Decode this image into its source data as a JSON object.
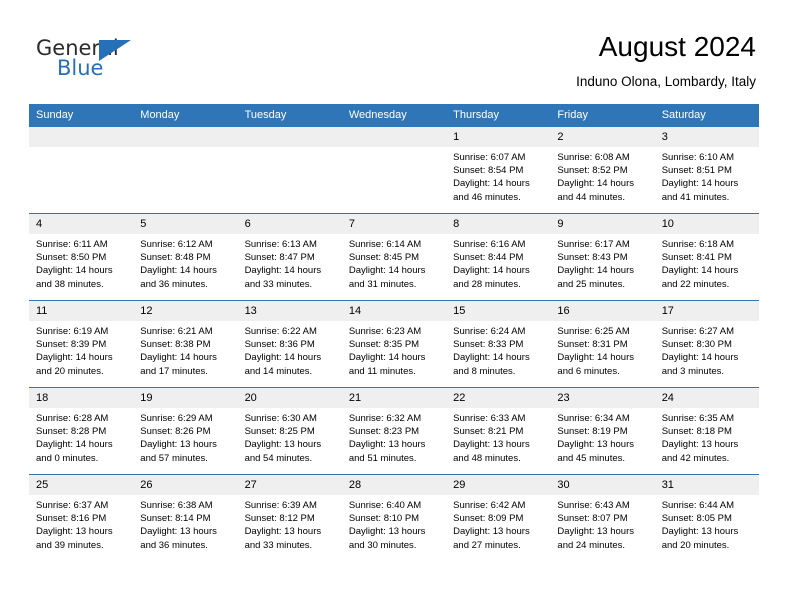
{
  "brand": {
    "word_general": "General",
    "word_blue": "Blue",
    "accent_color": "#2670b7"
  },
  "header": {
    "month_title": "August 2024",
    "location": "Induno Olona, Lombardy, Italy"
  },
  "calendar": {
    "header_color": "#2f76b8",
    "daynum_bg": "#efefef",
    "weekday_headers": [
      "Sunday",
      "Monday",
      "Tuesday",
      "Wednesday",
      "Thursday",
      "Friday",
      "Saturday"
    ],
    "weeks": [
      [
        {
          "day": "",
          "lines": []
        },
        {
          "day": "",
          "lines": []
        },
        {
          "day": "",
          "lines": []
        },
        {
          "day": "",
          "lines": []
        },
        {
          "day": "1",
          "lines": [
            "Sunrise: 6:07 AM",
            "Sunset: 8:54 PM",
            "Daylight: 14 hours",
            "and 46 minutes."
          ]
        },
        {
          "day": "2",
          "lines": [
            "Sunrise: 6:08 AM",
            "Sunset: 8:52 PM",
            "Daylight: 14 hours",
            "and 44 minutes."
          ]
        },
        {
          "day": "3",
          "lines": [
            "Sunrise: 6:10 AM",
            "Sunset: 8:51 PM",
            "Daylight: 14 hours",
            "and 41 minutes."
          ]
        }
      ],
      [
        {
          "day": "4",
          "lines": [
            "Sunrise: 6:11 AM",
            "Sunset: 8:50 PM",
            "Daylight: 14 hours",
            "and 38 minutes."
          ]
        },
        {
          "day": "5",
          "lines": [
            "Sunrise: 6:12 AM",
            "Sunset: 8:48 PM",
            "Daylight: 14 hours",
            "and 36 minutes."
          ]
        },
        {
          "day": "6",
          "lines": [
            "Sunrise: 6:13 AM",
            "Sunset: 8:47 PM",
            "Daylight: 14 hours",
            "and 33 minutes."
          ]
        },
        {
          "day": "7",
          "lines": [
            "Sunrise: 6:14 AM",
            "Sunset: 8:45 PM",
            "Daylight: 14 hours",
            "and 31 minutes."
          ]
        },
        {
          "day": "8",
          "lines": [
            "Sunrise: 6:16 AM",
            "Sunset: 8:44 PM",
            "Daylight: 14 hours",
            "and 28 minutes."
          ]
        },
        {
          "day": "9",
          "lines": [
            "Sunrise: 6:17 AM",
            "Sunset: 8:43 PM",
            "Daylight: 14 hours",
            "and 25 minutes."
          ]
        },
        {
          "day": "10",
          "lines": [
            "Sunrise: 6:18 AM",
            "Sunset: 8:41 PM",
            "Daylight: 14 hours",
            "and 22 minutes."
          ]
        }
      ],
      [
        {
          "day": "11",
          "lines": [
            "Sunrise: 6:19 AM",
            "Sunset: 8:39 PM",
            "Daylight: 14 hours",
            "and 20 minutes."
          ]
        },
        {
          "day": "12",
          "lines": [
            "Sunrise: 6:21 AM",
            "Sunset: 8:38 PM",
            "Daylight: 14 hours",
            "and 17 minutes."
          ]
        },
        {
          "day": "13",
          "lines": [
            "Sunrise: 6:22 AM",
            "Sunset: 8:36 PM",
            "Daylight: 14 hours",
            "and 14 minutes."
          ]
        },
        {
          "day": "14",
          "lines": [
            "Sunrise: 6:23 AM",
            "Sunset: 8:35 PM",
            "Daylight: 14 hours",
            "and 11 minutes."
          ]
        },
        {
          "day": "15",
          "lines": [
            "Sunrise: 6:24 AM",
            "Sunset: 8:33 PM",
            "Daylight: 14 hours",
            "and 8 minutes."
          ]
        },
        {
          "day": "16",
          "lines": [
            "Sunrise: 6:25 AM",
            "Sunset: 8:31 PM",
            "Daylight: 14 hours",
            "and 6 minutes."
          ]
        },
        {
          "day": "17",
          "lines": [
            "Sunrise: 6:27 AM",
            "Sunset: 8:30 PM",
            "Daylight: 14 hours",
            "and 3 minutes."
          ]
        }
      ],
      [
        {
          "day": "18",
          "lines": [
            "Sunrise: 6:28 AM",
            "Sunset: 8:28 PM",
            "Daylight: 14 hours",
            "and 0 minutes."
          ]
        },
        {
          "day": "19",
          "lines": [
            "Sunrise: 6:29 AM",
            "Sunset: 8:26 PM",
            "Daylight: 13 hours",
            "and 57 minutes."
          ]
        },
        {
          "day": "20",
          "lines": [
            "Sunrise: 6:30 AM",
            "Sunset: 8:25 PM",
            "Daylight: 13 hours",
            "and 54 minutes."
          ]
        },
        {
          "day": "21",
          "lines": [
            "Sunrise: 6:32 AM",
            "Sunset: 8:23 PM",
            "Daylight: 13 hours",
            "and 51 minutes."
          ]
        },
        {
          "day": "22",
          "lines": [
            "Sunrise: 6:33 AM",
            "Sunset: 8:21 PM",
            "Daylight: 13 hours",
            "and 48 minutes."
          ]
        },
        {
          "day": "23",
          "lines": [
            "Sunrise: 6:34 AM",
            "Sunset: 8:19 PM",
            "Daylight: 13 hours",
            "and 45 minutes."
          ]
        },
        {
          "day": "24",
          "lines": [
            "Sunrise: 6:35 AM",
            "Sunset: 8:18 PM",
            "Daylight: 13 hours",
            "and 42 minutes."
          ]
        }
      ],
      [
        {
          "day": "25",
          "lines": [
            "Sunrise: 6:37 AM",
            "Sunset: 8:16 PM",
            "Daylight: 13 hours",
            "and 39 minutes."
          ]
        },
        {
          "day": "26",
          "lines": [
            "Sunrise: 6:38 AM",
            "Sunset: 8:14 PM",
            "Daylight: 13 hours",
            "and 36 minutes."
          ]
        },
        {
          "day": "27",
          "lines": [
            "Sunrise: 6:39 AM",
            "Sunset: 8:12 PM",
            "Daylight: 13 hours",
            "and 33 minutes."
          ]
        },
        {
          "day": "28",
          "lines": [
            "Sunrise: 6:40 AM",
            "Sunset: 8:10 PM",
            "Daylight: 13 hours",
            "and 30 minutes."
          ]
        },
        {
          "day": "29",
          "lines": [
            "Sunrise: 6:42 AM",
            "Sunset: 8:09 PM",
            "Daylight: 13 hours",
            "and 27 minutes."
          ]
        },
        {
          "day": "30",
          "lines": [
            "Sunrise: 6:43 AM",
            "Sunset: 8:07 PM",
            "Daylight: 13 hours",
            "and 24 minutes."
          ]
        },
        {
          "day": "31",
          "lines": [
            "Sunrise: 6:44 AM",
            "Sunset: 8:05 PM",
            "Daylight: 13 hours",
            "and 20 minutes."
          ]
        }
      ]
    ]
  }
}
